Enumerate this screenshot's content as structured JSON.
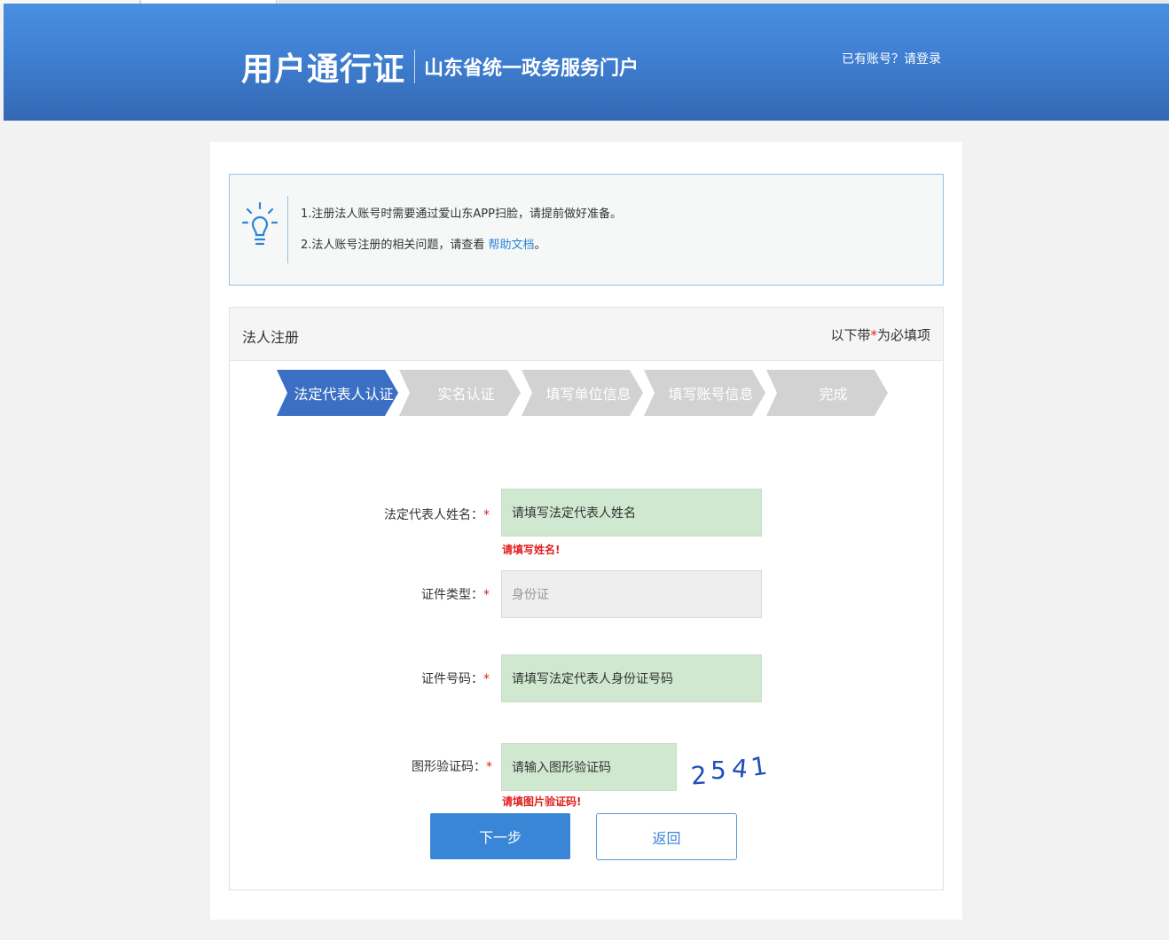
{
  "header": {
    "title": "用户通行证",
    "subtitle": "山东省统一政务服务门户",
    "login_link": "已有账号？请登录"
  },
  "notice": {
    "line1": "1.注册法人账号时需要通过爱山东APP扫脸，请提前做好准备。",
    "line2_prefix": "2.法人账号注册的相关问题，请查看",
    "help_link": "帮助文档",
    "line2_suffix": "。"
  },
  "registration": {
    "title": "法人注册",
    "required_note_prefix": "以下带",
    "required_star": "*",
    "required_note_suffix": "为必填项"
  },
  "steps": [
    {
      "label": "法定代表人认证",
      "active": true
    },
    {
      "label": "实名认证",
      "active": false
    },
    {
      "label": "填写单位信息",
      "active": false
    },
    {
      "label": "填写账号信息",
      "active": false
    },
    {
      "label": "完成",
      "active": false
    }
  ],
  "form": {
    "name": {
      "label": "法定代表人姓名：",
      "placeholder": "请填写法定代表人姓名",
      "error": "请填写姓名!"
    },
    "id_type": {
      "label": "证件类型：",
      "value": "身份证"
    },
    "id_number": {
      "label": "证件号码：",
      "placeholder": "请填写法定代表人身份证号码"
    },
    "captcha": {
      "label": "图形验证码：",
      "placeholder": "请输入图形验证码",
      "error": "请填图片验证码!",
      "image_text": "2541"
    },
    "required_star": "*"
  },
  "buttons": {
    "next": "下一步",
    "back": "返回"
  },
  "colors": {
    "header_blue": "#3f7fd2",
    "step_active": "#3a6fc4",
    "step_inactive": "#d2d2d2",
    "input_green": "#cfe8cf",
    "error_red": "#e02020",
    "link_blue": "#2a84d8"
  }
}
